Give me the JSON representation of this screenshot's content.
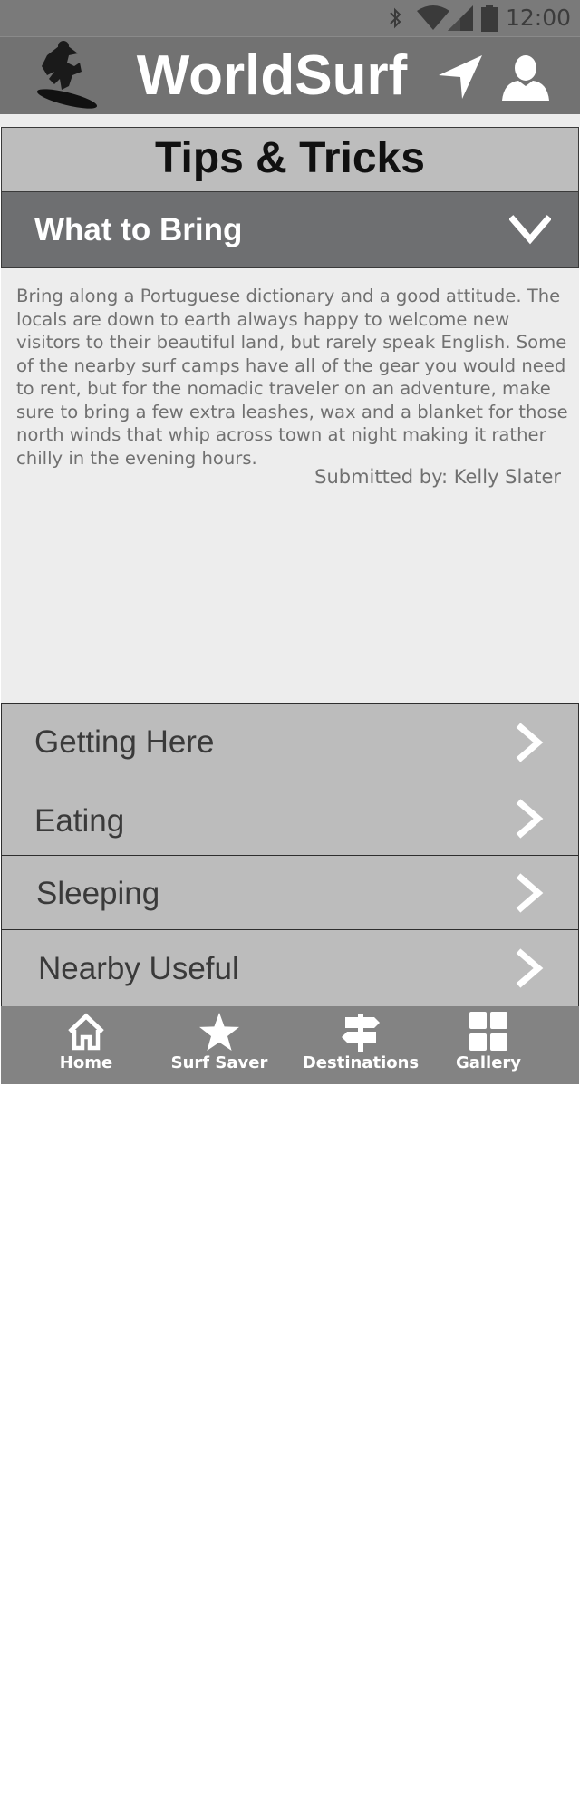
{
  "status_bar": {
    "time": "12:00",
    "icons": [
      "bluetooth-icon",
      "wifi-icon",
      "signal-icon",
      "battery-icon"
    ]
  },
  "app_bar": {
    "title": "WorldSurf",
    "icons": [
      "surfer-logo-icon",
      "location-arrow-icon",
      "user-profile-icon"
    ]
  },
  "section_title": "Tips & Tricks",
  "expanded_item": {
    "title": "What to Bring",
    "icon": "chevron-down-icon",
    "body": "Bring along a Portuguese  dictionary and a good attitude. The locals are down to earth always happy to welcome new visitors to their beautiful land, but rarely speak English. Some of the nearby surf camps have all of the gear you would need to rent, but for the nomadic traveler on an adventure, make sure to  bring a few extra leashes, wax and a blanket for those north winds that whip across town at night making it rather chilly in the evening hours.",
    "submitted_by": "Submitted by: Kelly Slater"
  },
  "list_items": [
    {
      "label": "Getting Here",
      "icon": "chevron-right-icon"
    },
    {
      "label": "Eating",
      "icon": "chevron-right-icon"
    },
    {
      "label": "Sleeping",
      "icon": "chevron-right-icon"
    },
    {
      "label": "Nearby Useful",
      "icon": "chevron-right-icon"
    }
  ],
  "tabs": [
    {
      "label": "Home",
      "icon": "home-icon"
    },
    {
      "label": "Surf Saver",
      "icon": "star-icon"
    },
    {
      "label": "Destinations",
      "icon": "signpost-icon"
    },
    {
      "label": "Gallery",
      "icon": "grid-icon"
    }
  ],
  "colors": {
    "status_bar": "#7a7a7a",
    "app_bar": "#727272",
    "section_header": "#bdbdbd",
    "expanded_header": "#6e6f71",
    "content_bg": "#ededed",
    "list_row": "#bcbcbc",
    "tab_bar": "#838383"
  }
}
